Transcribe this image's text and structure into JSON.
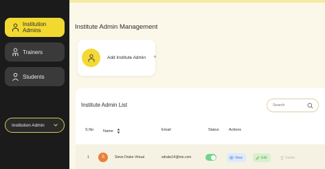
{
  "sidebar": {
    "items": [
      {
        "label": "Institution Admins",
        "active": true,
        "icon": "admin-icon"
      },
      {
        "label": "Trainers",
        "active": false,
        "icon": "trainer-icon"
      },
      {
        "label": "Students",
        "active": false,
        "icon": "student-icon"
      }
    ],
    "role_select": {
      "value": "Institution Admin"
    }
  },
  "main": {
    "page_title": "Institute Admin Management",
    "add_card": {
      "label": "Add Institute Admin",
      "plus": "+"
    },
    "list": {
      "title": "Institute Admin List",
      "search_placeholder": "Search",
      "columns": [
        "S.No",
        "Name",
        "Email",
        "Status",
        "Actions"
      ],
      "rows": [
        {
          "sno": "1",
          "avatar_initial": "S",
          "name": "Steve Drake Virtual",
          "email": "sdrake14@me.com",
          "status_on": true,
          "view": "View",
          "edit": "Edit",
          "delete": "Delete"
        }
      ]
    }
  },
  "colors": {
    "accent": "#f1d931",
    "sidebar_bg": "#1b1b1b",
    "toggle_on": "#6fd48f"
  }
}
